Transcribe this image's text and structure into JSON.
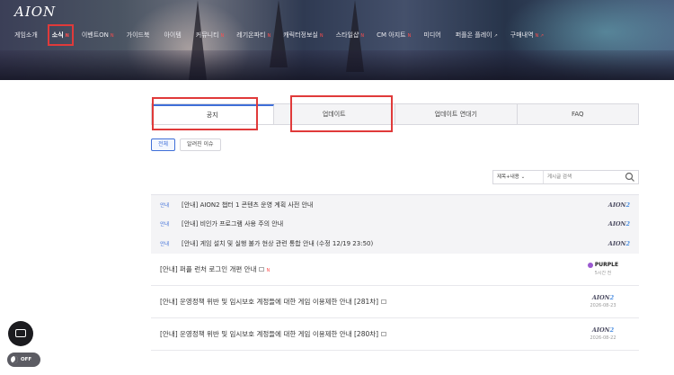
{
  "header": {
    "logo": "AION",
    "nav": [
      {
        "label": "게임소개",
        "badge": ""
      },
      {
        "label": "소식",
        "badge": "N"
      },
      {
        "label": "이벤트ON",
        "badge": "N"
      },
      {
        "label": "가이드북",
        "badge": ""
      },
      {
        "label": "아이템",
        "badge": ""
      },
      {
        "label": "커뮤니티",
        "badge": "N"
      },
      {
        "label": "레기온파티",
        "badge": "N"
      },
      {
        "label": "캐릭터정보실",
        "badge": "N"
      },
      {
        "label": "스타일샵",
        "badge": "N"
      },
      {
        "label": "CM 아지트",
        "badge": "N"
      },
      {
        "label": "미디어",
        "badge": ""
      },
      {
        "label": "퍼플온 플레이",
        "badge": "↗"
      },
      {
        "label": "구매내역",
        "badge": "N ↗"
      }
    ]
  },
  "tabs": [
    "공지",
    "업데이트",
    "업데이트 연대기",
    "FAQ"
  ],
  "filters": [
    "전체",
    "알려진 이슈"
  ],
  "search": {
    "select": "제목+내용",
    "placeholder": "게시글 검색"
  },
  "pinned": [
    {
      "tag": "안내",
      "title": "[안내] AION2 챕터 1 콘텐츠 운영 계획 사전 안내",
      "brand": "AION",
      "brand2": "2"
    },
    {
      "tag": "안내",
      "title": "[안내] 비인가 프로그램 사용 주의 안내",
      "brand": "AION",
      "brand2": "2"
    },
    {
      "tag": "안내",
      "title": "[안내] 게임 설치 및 실행 불가 현상 관련 통합 안내 (수정 12/19 23:50)",
      "brand": "AION",
      "brand2": "2"
    }
  ],
  "posts": [
    {
      "title": "[안내] 퍼플 런처 로그인 개편 안내",
      "new": "N",
      "brand": "PURPLE",
      "date": "5시간 전"
    },
    {
      "title": "[안내] 운영정책 위반 및 임시보호 계정들에 대한 게임 이용제한 안내 [281차]",
      "new": "",
      "brand": "AION",
      "brand2": "2",
      "date": "2026-08-23"
    },
    {
      "title": "[안내] 운영정책 위반 및 임시보호 계정들에 대한 게임 이용제한 안내 [280차]",
      "new": "",
      "brand": "AION",
      "brand2": "2",
      "date": "2026-08-22"
    }
  ],
  "toggle": {
    "label": "OFF"
  },
  "colors": {
    "accent": "#3f6fd8",
    "highlight": "#e03a3a"
  }
}
